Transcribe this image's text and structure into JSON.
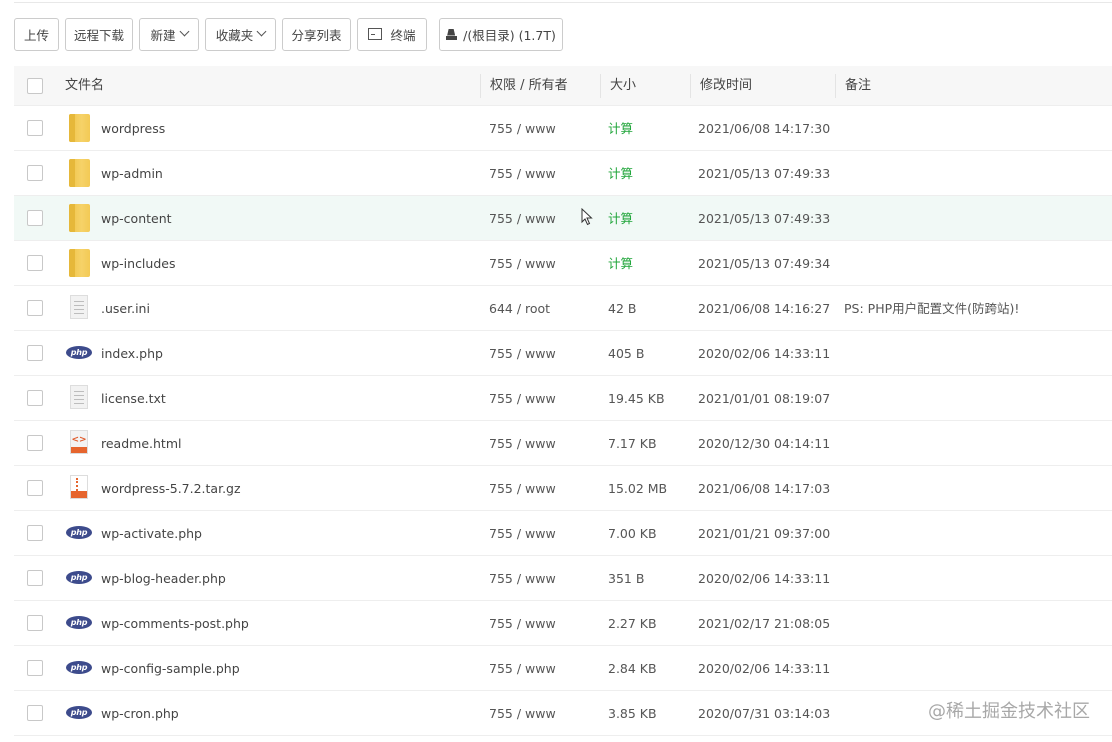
{
  "toolbar": {
    "upload": "上传",
    "remote_download": "远程下载",
    "new": "新建",
    "favorites": "收藏夹",
    "share_list": "分享列表",
    "terminal": "终端",
    "path": "/(根目录) (1.7T)"
  },
  "columns": {
    "name": "文件名",
    "perm": "权限 / 所有者",
    "size": "大小",
    "mtime": "修改时间",
    "note": "备注"
  },
  "rows": [
    {
      "name": "wordpress",
      "type": "folder",
      "perm": "755 / www",
      "size": "计算",
      "mtime": "2021/06/08 14:17:30",
      "note": ""
    },
    {
      "name": "wp-admin",
      "type": "folder",
      "perm": "755 / www",
      "size": "计算",
      "mtime": "2021/05/13 07:49:33",
      "note": ""
    },
    {
      "name": "wp-content",
      "type": "folder",
      "perm": "755 / www",
      "size": "计算",
      "mtime": "2021/05/13 07:49:33",
      "note": ""
    },
    {
      "name": "wp-includes",
      "type": "folder",
      "perm": "755 / www",
      "size": "计算",
      "mtime": "2021/05/13 07:49:34",
      "note": ""
    },
    {
      "name": ".user.ini",
      "type": "text",
      "perm": "644 / root",
      "size": "42 B",
      "mtime": "2021/06/08 14:16:27",
      "note": "PS: PHP用户配置文件(防跨站)!"
    },
    {
      "name": "index.php",
      "type": "php",
      "perm": "755 / www",
      "size": "405 B",
      "mtime": "2020/02/06 14:33:11",
      "note": ""
    },
    {
      "name": "license.txt",
      "type": "text",
      "perm": "755 / www",
      "size": "19.45 KB",
      "mtime": "2021/01/01 08:19:07",
      "note": ""
    },
    {
      "name": "readme.html",
      "type": "html",
      "perm": "755 / www",
      "size": "7.17 KB",
      "mtime": "2020/12/30 04:14:11",
      "note": ""
    },
    {
      "name": "wordpress-5.7.2.tar.gz",
      "type": "tar",
      "perm": "755 / www",
      "size": "15.02 MB",
      "mtime": "2021/06/08 14:17:03",
      "note": ""
    },
    {
      "name": "wp-activate.php",
      "type": "php",
      "perm": "755 / www",
      "size": "7.00 KB",
      "mtime": "2021/01/21 09:37:00",
      "note": ""
    },
    {
      "name": "wp-blog-header.php",
      "type": "php",
      "perm": "755 / www",
      "size": "351 B",
      "mtime": "2020/02/06 14:33:11",
      "note": ""
    },
    {
      "name": "wp-comments-post.php",
      "type": "php",
      "perm": "755 / www",
      "size": "2.27 KB",
      "mtime": "2021/02/17 21:08:05",
      "note": ""
    },
    {
      "name": "wp-config-sample.php",
      "type": "php",
      "perm": "755 / www",
      "size": "2.84 KB",
      "mtime": "2020/02/06 14:33:11",
      "note": ""
    },
    {
      "name": "wp-cron.php",
      "type": "php",
      "perm": "755 / www",
      "size": "3.85 KB",
      "mtime": "2020/07/31 03:14:03",
      "note": ""
    }
  ],
  "hover_row": 2,
  "colors": {
    "calc_link": "#20a53a",
    "hover_bg": "#f1f9f6",
    "php_badge": "#3d4b8c"
  },
  "php_badge_text": "php",
  "html_badge_text": "HTML",
  "tar_badge_text": "TAR",
  "watermark": "@稀土掘金技术社区"
}
